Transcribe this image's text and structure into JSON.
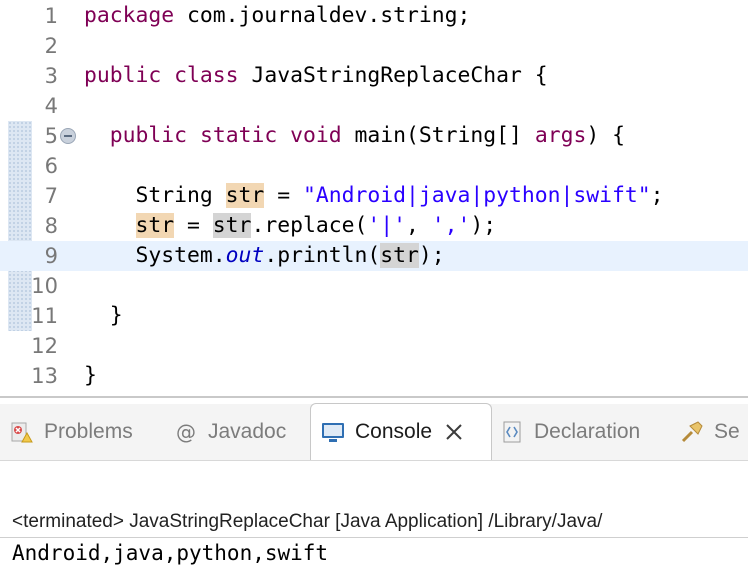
{
  "editor": {
    "lines": [
      {
        "num": "1",
        "tokens": [
          {
            "t": "package",
            "c": "kw"
          },
          {
            "t": " com.journaldev.string;",
            "c": ""
          }
        ]
      },
      {
        "num": "2",
        "tokens": []
      },
      {
        "num": "3",
        "tokens": [
          {
            "t": "public",
            "c": "kw"
          },
          {
            "t": " ",
            "c": ""
          },
          {
            "t": "class",
            "c": "kw"
          },
          {
            "t": " JavaStringReplaceChar {",
            "c": ""
          }
        ]
      },
      {
        "num": "4",
        "tokens": []
      },
      {
        "num": "5",
        "tokens": [
          {
            "t": "  ",
            "c": ""
          },
          {
            "t": "public",
            "c": "kw"
          },
          {
            "t": " ",
            "c": ""
          },
          {
            "t": "static",
            "c": "kw"
          },
          {
            "t": " ",
            "c": ""
          },
          {
            "t": "void",
            "c": "kw"
          },
          {
            "t": " main(String[] ",
            "c": ""
          },
          {
            "t": "args",
            "c": "kw"
          },
          {
            "t": ") {",
            "c": ""
          }
        ],
        "fold": true
      },
      {
        "num": "6",
        "tokens": []
      },
      {
        "num": "7",
        "tokens": [
          {
            "t": "    String ",
            "c": ""
          },
          {
            "t": "str",
            "c": "occ-w"
          },
          {
            "t": " = ",
            "c": ""
          },
          {
            "t": "\"Android|java|python|swift\"",
            "c": "str"
          },
          {
            "t": ";",
            "c": ""
          }
        ]
      },
      {
        "num": "8",
        "tokens": [
          {
            "t": "    ",
            "c": ""
          },
          {
            "t": "str",
            "c": "occ-w"
          },
          {
            "t": " = ",
            "c": ""
          },
          {
            "t": "str",
            "c": "occ-r"
          },
          {
            "t": ".replace(",
            "c": ""
          },
          {
            "t": "'|'",
            "c": "str"
          },
          {
            "t": ", ",
            "c": ""
          },
          {
            "t": "','",
            "c": "str"
          },
          {
            "t": ");",
            "c": ""
          }
        ]
      },
      {
        "num": "9",
        "tokens": [
          {
            "t": "    System.",
            "c": ""
          },
          {
            "t": "out",
            "c": "fld"
          },
          {
            "t": ".println(",
            "c": ""
          },
          {
            "t": "str",
            "c": "occ-r"
          },
          {
            "t": ");",
            "c": ""
          }
        ],
        "current": true
      },
      {
        "num": "10",
        "tokens": []
      },
      {
        "num": "11",
        "tokens": [
          {
            "t": "  }",
            "c": ""
          }
        ]
      },
      {
        "num": "12",
        "tokens": []
      },
      {
        "num": "13",
        "tokens": [
          {
            "t": "}",
            "c": ""
          }
        ]
      }
    ]
  },
  "tabs": [
    {
      "label": "Problems",
      "icon": "problems-icon",
      "active": false
    },
    {
      "label": "Javadoc",
      "icon": "javadoc-icon",
      "active": false
    },
    {
      "label": "Console",
      "icon": "console-icon",
      "active": true
    },
    {
      "label": "Declaration",
      "icon": "declaration-icon",
      "active": false
    },
    {
      "label": "Se",
      "icon": "search-icon",
      "active": false
    }
  ],
  "console": {
    "terminated": "<terminated> JavaStringReplaceChar [Java Application] /Library/Java/",
    "output": "Android,java,python,swift"
  },
  "colors": {
    "keyword": "#7f0055",
    "string": "#2a00ff",
    "field": "#0000c0",
    "current_line": "#e8f2fe",
    "write_occurrence": "#f2d7b3",
    "read_occurrence": "#d4d4d4"
  }
}
